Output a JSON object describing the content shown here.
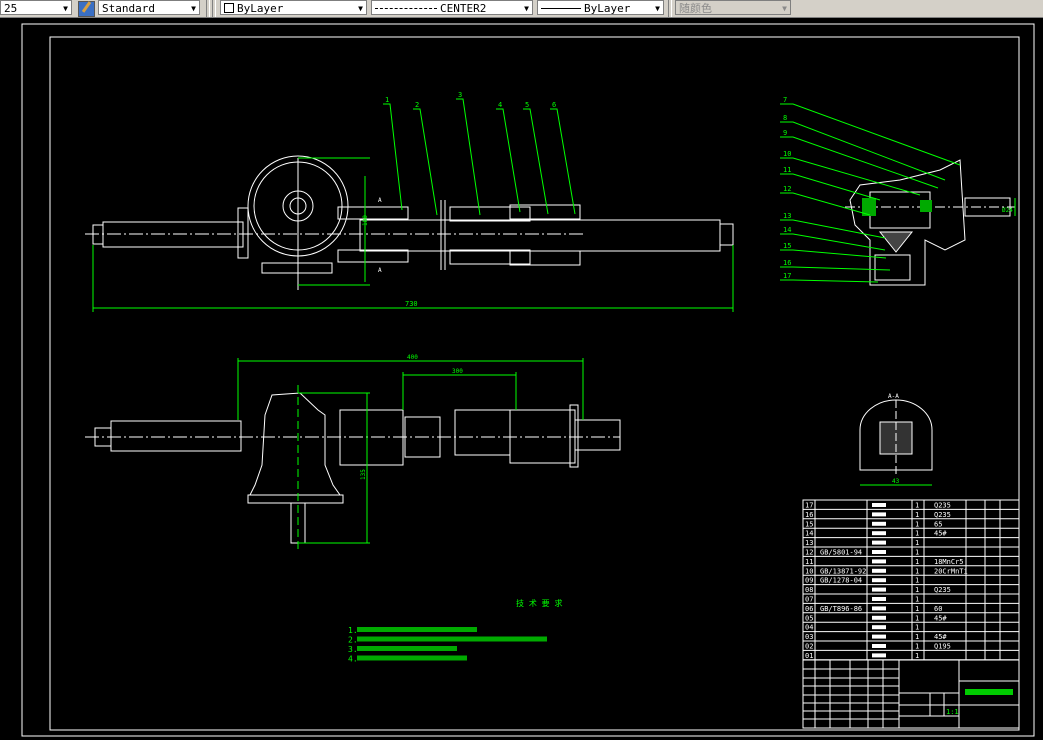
{
  "toolbar": {
    "scale_value": "25",
    "text_style": "Standard",
    "layer": "ByLayer",
    "linetype": "CENTER2",
    "lineweight": "ByLayer",
    "color": "随颜色"
  },
  "colors": {
    "background": "#000000",
    "geometry": "#ffffff",
    "annotation": "#00ff00",
    "toolbar": "#d4d0c8"
  },
  "drawing": {
    "balloons_top": [
      "1",
      "2",
      "3",
      "4",
      "5",
      "6"
    ],
    "balloons_side": [
      "7",
      "8",
      "9",
      "10",
      "11",
      "12",
      "13",
      "14",
      "15",
      "16",
      "17"
    ],
    "section_label": "A-A",
    "section_mark": "A",
    "dims": {
      "overall_length": "730",
      "front_height": "180",
      "plan_length": "400",
      "plan_inner": "300",
      "plan_height": "135",
      "section_width": "43",
      "flange_dia": "Ø24"
    }
  },
  "tech_requirements": {
    "title": "技 术 要 求",
    "items": [
      "1.",
      "2.",
      "3.",
      "4."
    ]
  },
  "parts_table": {
    "rows": [
      {
        "no": "17",
        "code": "",
        "qty": "1",
        "material": "Q235"
      },
      {
        "no": "16",
        "code": "",
        "qty": "1",
        "material": "Q235"
      },
      {
        "no": "15",
        "code": "",
        "qty": "1",
        "material": "65"
      },
      {
        "no": "14",
        "code": "",
        "qty": "1",
        "material": "45#"
      },
      {
        "no": "13",
        "code": "",
        "qty": "1",
        "material": ""
      },
      {
        "no": "12",
        "code": "GB/5801-94",
        "qty": "1",
        "material": ""
      },
      {
        "no": "11",
        "code": "",
        "qty": "1",
        "material": "18MnCr5"
      },
      {
        "no": "10",
        "code": "GB/13871-92",
        "qty": "1",
        "material": "20CrMnTi"
      },
      {
        "no": "09",
        "code": "GB/1278-04",
        "qty": "1",
        "material": ""
      },
      {
        "no": "08",
        "code": "",
        "qty": "1",
        "material": "Q235"
      },
      {
        "no": "07",
        "code": "",
        "qty": "1",
        "material": ""
      },
      {
        "no": "06",
        "code": "GB/T896-86",
        "qty": "1",
        "material": "60"
      },
      {
        "no": "05",
        "code": "",
        "qty": "1",
        "material": "45#"
      },
      {
        "no": "04",
        "code": "",
        "qty": "1",
        "material": ""
      },
      {
        "no": "03",
        "code": "",
        "qty": "1",
        "material": "45#"
      },
      {
        "no": "02",
        "code": "",
        "qty": "1",
        "material": "Q195"
      },
      {
        "no": "01",
        "code": "",
        "qty": "1",
        "material": ""
      }
    ]
  },
  "title_block": {
    "scale": "1:1"
  }
}
